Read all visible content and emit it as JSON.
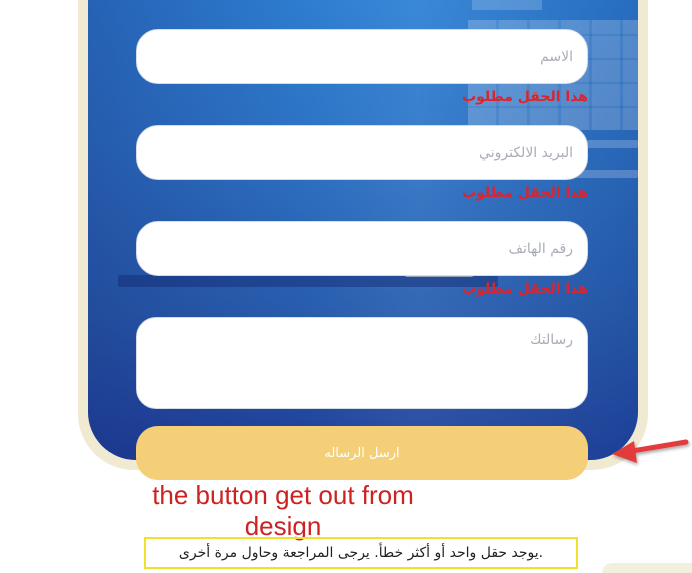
{
  "form": {
    "name_placeholder": "الاسم",
    "email_placeholder": "البريد الالكتروني",
    "phone_placeholder": "رقم الهاتف",
    "message_placeholder": "رسالتك",
    "required_error": "هذا الحقل مطلوب",
    "submit_label": "ارسل الرساله"
  },
  "annotation": {
    "text": "the button get out from design"
  },
  "notice": {
    "text": ".يوجد حقل واحد أو أكثر خطأ. يرجى المراجعة وحاول مرة أخرى"
  },
  "colors": {
    "error": "#d9252f",
    "button": "#f4cf78",
    "annotation": "#cc2222",
    "notice_border": "#f2e12b",
    "card_blue": "#2f77c8",
    "frame": "#f1ead3"
  }
}
